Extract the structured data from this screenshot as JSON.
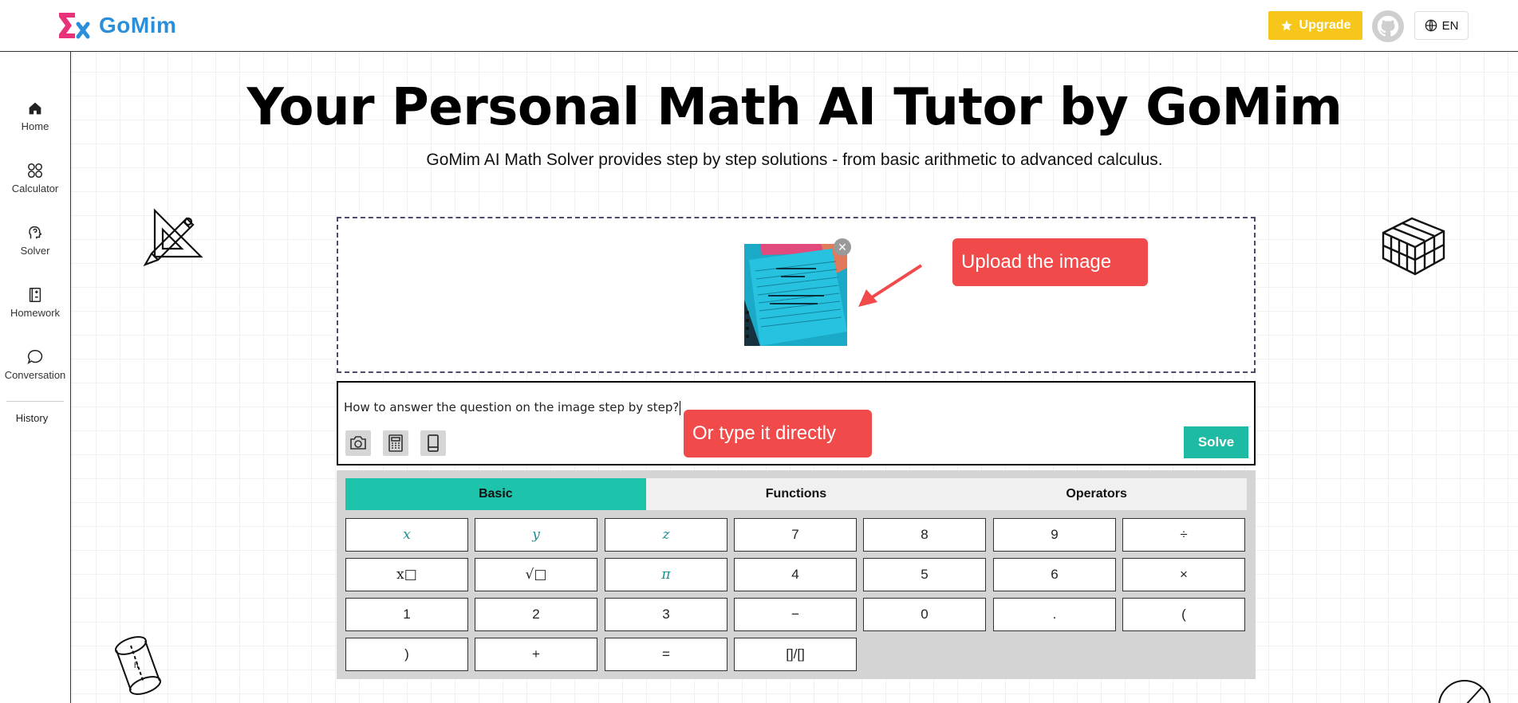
{
  "header": {
    "logo_text": "GoMim",
    "upgrade_label": "Upgrade",
    "lang_label": "EN"
  },
  "sidebar": {
    "items": [
      {
        "label": "Home",
        "icon": "home-icon"
      },
      {
        "label": "Calculator",
        "icon": "calculator-icon"
      },
      {
        "label": "Solver",
        "icon": "solver-icon"
      },
      {
        "label": "Homework",
        "icon": "homework-icon"
      },
      {
        "label": "Conversation",
        "icon": "chat-icon"
      }
    ],
    "history_label": "History"
  },
  "hero": {
    "title": "Your Personal Math AI Tutor by GoMim",
    "subtitle": "GoMim AI Math Solver provides step by step solutions - from basic arithmetic to advanced calculus."
  },
  "annotations": {
    "upload": "Upload the image",
    "type": "Or type it directly"
  },
  "input": {
    "value": "How to answer the question on the image step by step?",
    "solve_label": "Solve"
  },
  "keypad": {
    "tabs": [
      "Basic",
      "Functions",
      "Operators"
    ],
    "active_tab": "Basic",
    "keys": [
      "x",
      "y",
      "z",
      "7",
      "8",
      "9",
      "÷",
      "x□",
      "√□",
      "π",
      "4",
      "5",
      "6",
      "×",
      "1",
      "2",
      "3",
      "−",
      "0",
      ".",
      "(",
      ")",
      "+",
      "=",
      "[]/[]"
    ]
  },
  "colors": {
    "accent": "#1dc3ab",
    "upgrade": "#f6c61a",
    "annotation": "#f04a4a",
    "logo": "#2a8fd8"
  }
}
